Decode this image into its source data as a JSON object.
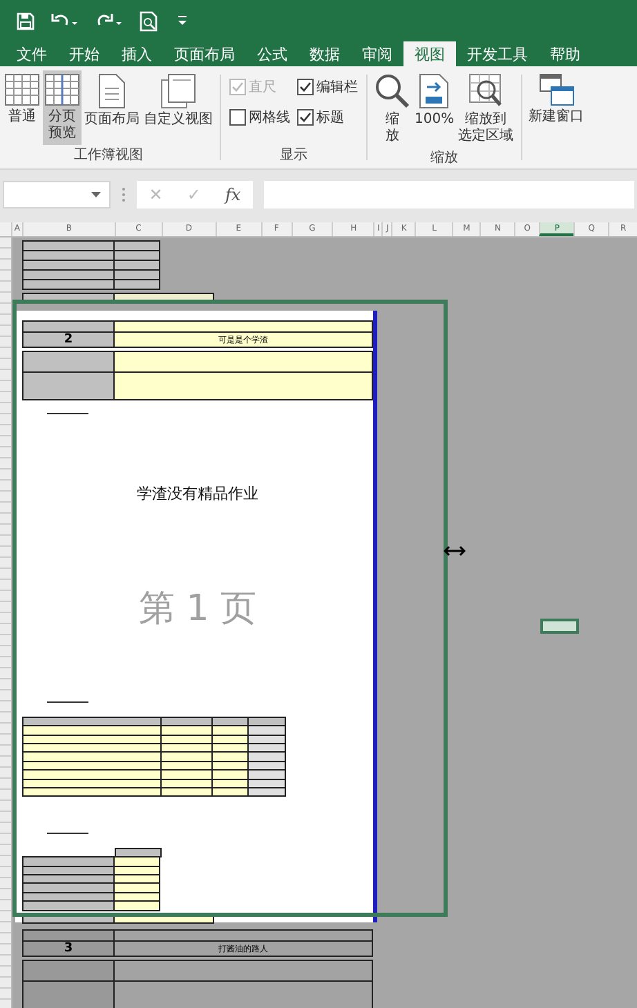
{
  "tabs": [
    {
      "label": "文件",
      "selected": false
    },
    {
      "label": "开始",
      "selected": false
    },
    {
      "label": "插入",
      "selected": false
    },
    {
      "label": "页面布局",
      "selected": false
    },
    {
      "label": "公式",
      "selected": false
    },
    {
      "label": "数据",
      "selected": false
    },
    {
      "label": "审阅",
      "selected": false
    },
    {
      "label": "视图",
      "selected": true
    },
    {
      "label": "开发工具",
      "selected": false
    },
    {
      "label": "帮助",
      "selected": false
    }
  ],
  "ribbon": {
    "views": {
      "label": "工作簿视图",
      "buttons": [
        {
          "kind": "normal",
          "lines": [
            "普通"
          ],
          "selected": false
        },
        {
          "kind": "pagebreak",
          "lines": [
            "分页",
            "预览"
          ],
          "selected": true
        },
        {
          "kind": "layout",
          "lines": [
            "页面布局"
          ],
          "selected": false
        },
        {
          "kind": "custom",
          "lines": [
            "自定义视图"
          ],
          "selected": false
        }
      ]
    },
    "show": {
      "label": "显示",
      "options": [
        {
          "label": "直尺",
          "checked": true,
          "disabled": true
        },
        {
          "label": "编辑栏",
          "checked": true,
          "disabled": false
        },
        {
          "label": "网格线",
          "checked": false,
          "disabled": false
        },
        {
          "label": "标题",
          "checked": true,
          "disabled": false
        }
      ]
    },
    "zoom": {
      "label": "缩放",
      "buttons": [
        {
          "kind": "zoom",
          "lines": [
            "缩",
            "放"
          ]
        },
        {
          "kind": "hundred",
          "lines": [
            "100%"
          ]
        },
        {
          "kind": "selection",
          "lines": [
            "缩放到",
            "选定区域"
          ]
        }
      ]
    },
    "window": {
      "buttons": [
        {
          "kind": "newwindow",
          "lines": [
            "新建窗口"
          ]
        }
      ]
    }
  },
  "formula_bar": {
    "cancel": "✕",
    "enter": "✓",
    "function": "fx"
  },
  "columns": [
    {
      "label": "A",
      "selected": false
    },
    {
      "label": "B",
      "selected": false
    },
    {
      "label": "C",
      "selected": false
    },
    {
      "label": "D",
      "selected": false
    },
    {
      "label": "E",
      "selected": false
    },
    {
      "label": "F",
      "selected": false
    },
    {
      "label": "G",
      "selected": false
    },
    {
      "label": "H",
      "selected": false
    },
    {
      "label": "I",
      "selected": false
    },
    {
      "label": "J",
      "selected": false
    },
    {
      "label": "K",
      "selected": false
    },
    {
      "label": "L",
      "selected": false
    },
    {
      "label": "M",
      "selected": false
    },
    {
      "label": "N",
      "selected": false
    },
    {
      "label": "O",
      "selected": false
    },
    {
      "label": "P",
      "selected": true
    },
    {
      "label": "Q",
      "selected": false
    },
    {
      "label": "R",
      "selected": false
    }
  ],
  "page": {
    "label": "第 1 页",
    "block": {
      "number": "2",
      "name": "可是是个学渣"
    },
    "heading": "学渣没有精品作业"
  },
  "next_block": {
    "number": "3",
    "name": "打酱油的路人"
  }
}
